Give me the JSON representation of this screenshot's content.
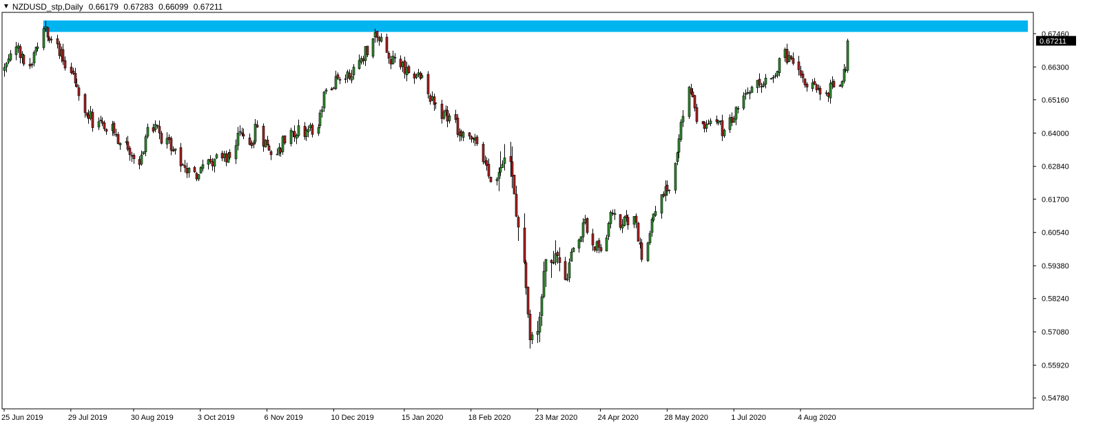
{
  "header": {
    "dropdown_icon": "triangle-down-icon",
    "symbol": "NZDUSD_stp,Daily",
    "open": "0.66179",
    "high": "0.67283",
    "low": "0.66099",
    "close": "0.67211"
  },
  "colors": {
    "background": "#ffffff",
    "bull_body": "#2e8b2e",
    "bear_body": "#a52020",
    "wick": "#000000",
    "zone": "#00b4f0",
    "current_price_bg": "#000000"
  },
  "chart_data": {
    "type": "candlestick",
    "symbol": "NZDUSD_stp",
    "timeframe": "Daily",
    "ylim": [
      0.544,
      0.682
    ],
    "y_ticks": [
      "0.67460",
      "0.66300",
      "0.65160",
      "0.64000",
      "0.62840",
      "0.61700",
      "0.60540",
      "0.59380",
      "0.58240",
      "0.57080",
      "0.55920",
      "0.54780"
    ],
    "x_ticks": [
      "25 Jun 2019",
      "29 Jul 2019",
      "30 Aug 2019",
      "3 Oct 2019",
      "6 Nov 2019",
      "10 Dec 2019",
      "15 Jan 2020",
      "18 Feb 2020",
      "23 Mar 2020",
      "24 Apr 2020",
      "28 May 2020",
      "1 Jul 2020",
      "4 Aug 2020"
    ],
    "current_price": "0.67211",
    "zone": {
      "low": 0.6752,
      "high": 0.6792,
      "from": "15 Jul 2019",
      "extends_right": true
    },
    "anchors": [
      {
        "d": "25 Jun 2019",
        "c": 0.662
      },
      {
        "d": "1 Jul 2019",
        "c": 0.67
      },
      {
        "d": "5 Jul 2019",
        "c": 0.664
      },
      {
        "d": "9 Jul 2019",
        "c": 0.664
      },
      {
        "d": "12 Jul 2019",
        "c": 0.67
      },
      {
        "d": "16 Jul 2019",
        "c": 0.677
      },
      {
        "d": "22 Jul 2019",
        "c": 0.671
      },
      {
        "d": "29 Jul 2019",
        "c": 0.661
      },
      {
        "d": "2 Aug 2019",
        "c": 0.653
      },
      {
        "d": "7 Aug 2019",
        "c": 0.645
      },
      {
        "d": "12 Aug 2019",
        "c": 0.644
      },
      {
        "d": "20 Aug 2019",
        "c": 0.64
      },
      {
        "d": "26 Aug 2019",
        "c": 0.637
      },
      {
        "d": "2 Sep 2019",
        "c": 0.629
      },
      {
        "d": "6 Sep 2019",
        "c": 0.642
      },
      {
        "d": "12 Sep 2019",
        "c": 0.64
      },
      {
        "d": "18 Sep 2019",
        "c": 0.634
      },
      {
        "d": "25 Sep 2019",
        "c": 0.628
      },
      {
        "d": "1 Oct 2019",
        "c": 0.624
      },
      {
        "d": "4 Oct 2019",
        "c": 0.629
      },
      {
        "d": "10 Oct 2019",
        "c": 0.631
      },
      {
        "d": "16 Oct 2019",
        "c": 0.63
      },
      {
        "d": "22 Oct 2019",
        "c": 0.64
      },
      {
        "d": "28 Oct 2019",
        "c": 0.636
      },
      {
        "d": "1 Nov 2019",
        "c": 0.642
      },
      {
        "d": "7 Nov 2019",
        "c": 0.634
      },
      {
        "d": "12 Nov 2019",
        "c": 0.635
      },
      {
        "d": "18 Nov 2019",
        "c": 0.641
      },
      {
        "d": "26 Nov 2019",
        "c": 0.641
      },
      {
        "d": "2 Dec 2019",
        "c": 0.642
      },
      {
        "d": "6 Dec 2019",
        "c": 0.655
      },
      {
        "d": "12 Dec 2019",
        "c": 0.659
      },
      {
        "d": "18 Dec 2019",
        "c": 0.659
      },
      {
        "d": "24 Dec 2019",
        "c": 0.666
      },
      {
        "d": "31 Dec 2019",
        "c": 0.675
      },
      {
        "d": "7 Jan 2020",
        "c": 0.666
      },
      {
        "d": "13 Jan 2020",
        "c": 0.663
      },
      {
        "d": "17 Jan 2020",
        "c": 0.661
      },
      {
        "d": "22 Jan 2020",
        "c": 0.661
      },
      {
        "d": "28 Jan 2020",
        "c": 0.651
      },
      {
        "d": "3 Feb 2020",
        "c": 0.645
      },
      {
        "d": "7 Feb 2020",
        "c": 0.646
      },
      {
        "d": "13 Feb 2020",
        "c": 0.639
      },
      {
        "d": "19 Feb 2020",
        "c": 0.638
      },
      {
        "d": "24 Feb 2020",
        "c": 0.63
      },
      {
        "d": "28 Feb 2020",
        "c": 0.623
      },
      {
        "d": "4 Mar 2020",
        "c": 0.628
      },
      {
        "d": "9 Mar 2020",
        "c": 0.63
      },
      {
        "d": "12 Mar 2020",
        "c": 0.611
      },
      {
        "d": "16 Mar 2020",
        "c": 0.595
      },
      {
        "d": "18 Mar 2020",
        "c": 0.577
      },
      {
        "d": "19 Mar 2020",
        "c": 0.568
      },
      {
        "d": "23 Mar 2020",
        "c": 0.571
      },
      {
        "d": "25 Mar 2020",
        "c": 0.583
      },
      {
        "d": "27 Mar 2020",
        "c": 0.596
      },
      {
        "d": "1 Apr 2020",
        "c": 0.598
      },
      {
        "d": "6 Apr 2020",
        "c": 0.589
      },
      {
        "d": "10 Apr 2020",
        "c": 0.6
      },
      {
        "d": "16 Apr 2020",
        "c": 0.61
      },
      {
        "d": "20 Apr 2020",
        "c": 0.601
      },
      {
        "d": "24 Apr 2020",
        "c": 0.599
      },
      {
        "d": "30 Apr 2020",
        "c": 0.612
      },
      {
        "d": "5 May 2020",
        "c": 0.608
      },
      {
        "d": "11 May 2020",
        "c": 0.611
      },
      {
        "d": "15 May 2020",
        "c": 0.596
      },
      {
        "d": "20 May 2020",
        "c": 0.61
      },
      {
        "d": "26 May 2020",
        "c": 0.618
      },
      {
        "d": "29 May 2020",
        "c": 0.62
      },
      {
        "d": "3 Jun 2020",
        "c": 0.638
      },
      {
        "d": "8 Jun 2020",
        "c": 0.656
      },
      {
        "d": "12 Jun 2020",
        "c": 0.644
      },
      {
        "d": "17 Jun 2020",
        "c": 0.643
      },
      {
        "d": "22 Jun 2020",
        "c": 0.644
      },
      {
        "d": "26 Jun 2020",
        "c": 0.641
      },
      {
        "d": "1 Jul 2020",
        "c": 0.645
      },
      {
        "d": "6 Jul 2020",
        "c": 0.653
      },
      {
        "d": "10 Jul 2020",
        "c": 0.656
      },
      {
        "d": "15 Jul 2020",
        "c": 0.656
      },
      {
        "d": "20 Jul 2020",
        "c": 0.659
      },
      {
        "d": "24 Jul 2020",
        "c": 0.666
      },
      {
        "d": "29 Jul 2020",
        "c": 0.667
      },
      {
        "d": "3 Aug 2020",
        "c": 0.662
      },
      {
        "d": "7 Aug 2020",
        "c": 0.656
      },
      {
        "d": "12 Aug 2020",
        "c": 0.655
      },
      {
        "d": "17 Aug 2020",
        "c": 0.654
      },
      {
        "d": "21 Aug 2020",
        "c": 0.656
      },
      {
        "d": "25 Aug 2020",
        "c": 0.658
      },
      {
        "d": "27 Aug 2020",
        "c": 0.662
      },
      {
        "d": "28 Aug 2020",
        "c": 0.6721
      }
    ]
  }
}
